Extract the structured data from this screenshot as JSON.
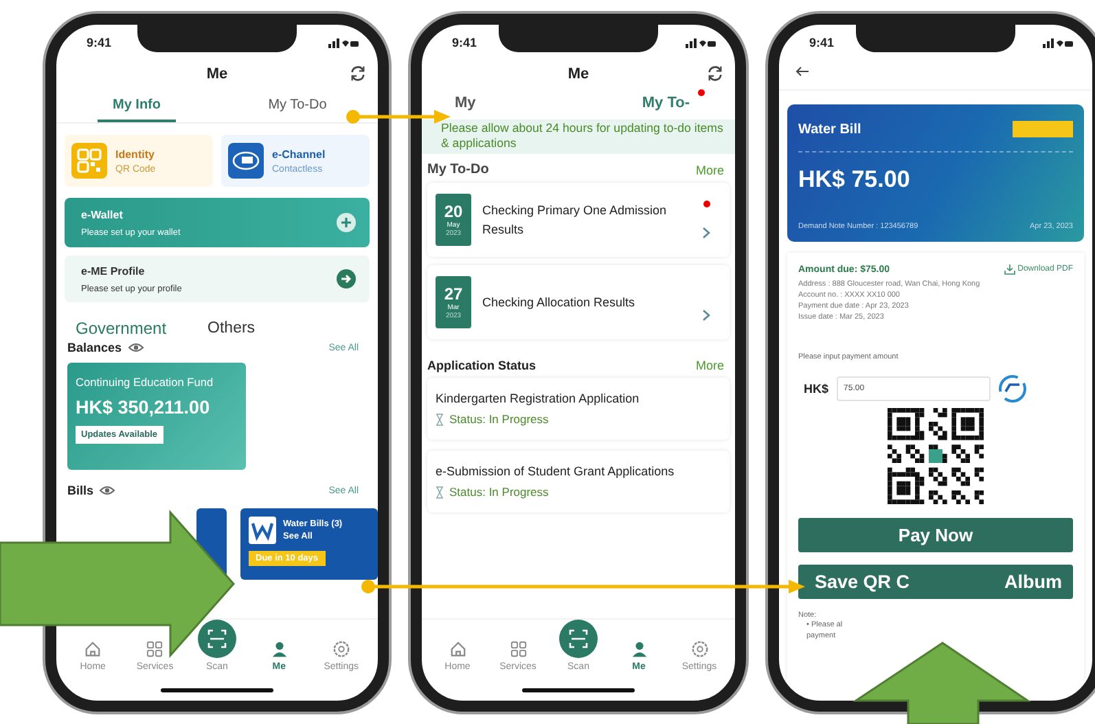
{
  "my_info_screen": {
    "time": "9:41",
    "title": "Me",
    "tabs": [
      {
        "label": "My Info",
        "selected": true
      },
      {
        "label": "My To-Do",
        "selected": false
      }
    ],
    "tiles": [
      {
        "kind": "qr",
        "title": "Identity",
        "subtitle": "QR Code"
      },
      {
        "kind": "echannel",
        "title": "e-Channel",
        "subtitle": "Contactless"
      }
    ],
    "cards": [
      {
        "kind": "wallet",
        "title": "e-Wallet",
        "subtitle": "Please set up your wallet"
      },
      {
        "kind": "profile",
        "title": "e-ME Profile",
        "subtitle": "Please set up your profile"
      }
    ],
    "segments": [
      {
        "label": "Government",
        "selected": true
      },
      {
        "label": "Others",
        "selected": false
      }
    ],
    "balances": {
      "title": "Balances",
      "see_all": "See All",
      "fund": "Continuing Education Fund",
      "amount": "HK$ 350,211.00",
      "badge": "Updates Available"
    },
    "bills": {
      "title": "Bills",
      "see_all": "See All",
      "card": {
        "title": "Water Bills (3)",
        "link": "See All",
        "due": "Due in 10 days"
      }
    },
    "nav": [
      {
        "kind": "home",
        "label": "Home",
        "selected": false
      },
      {
        "kind": "services",
        "label": "Services",
        "selected": false
      },
      {
        "kind": "scan",
        "label": "Scan",
        "selected": false
      },
      {
        "kind": "me",
        "label": "Me",
        "selected": true
      },
      {
        "kind": "settings",
        "label": "Settings",
        "selected": false
      }
    ]
  },
  "my_todo_screen": {
    "time": "9:41",
    "title": "Me",
    "tabs": [
      {
        "label": "My",
        "selected": false,
        "unread": false
      },
      {
        "label": "My To-",
        "selected": true,
        "unread": true
      }
    ],
    "banner": "Please allow about 24 hours for updating to-do items & applications",
    "todo_section": {
      "title": "My To-Do",
      "more": "More"
    },
    "todos": [
      {
        "day": "20",
        "month": "May",
        "year": "2023",
        "title": "Checking Primary One Admission Results",
        "unread": true
      },
      {
        "day": "27",
        "month": "Mar",
        "year": "2023",
        "title": "Checking Allocation Results",
        "unread": false
      }
    ],
    "applications_section": {
      "title": "Application Status",
      "more": "More"
    },
    "applications": [
      {
        "title": "Kindergarten Registration Application",
        "status": "Status: In Progress"
      },
      {
        "title": "e-Submission of Student Grant Applications",
        "status": "Status: In Progress"
      }
    ],
    "nav": [
      {
        "kind": "home",
        "label": "Home",
        "selected": false
      },
      {
        "kind": "services",
        "label": "Services",
        "selected": false
      },
      {
        "kind": "scan",
        "label": "Scan",
        "selected": false
      },
      {
        "kind": "me",
        "label": "Me",
        "selected": true
      },
      {
        "kind": "settings",
        "label": "Settings",
        "selected": false
      }
    ]
  },
  "water_bill_screen": {
    "time": "9:41",
    "bill_card": {
      "title": "Water Bill",
      "amount": "HK$ 75.00",
      "demand_note": "Demand Note Number : 123456789",
      "date": "Apr 23, 2023"
    },
    "details": {
      "amount_due": "Amount due: $75.00",
      "download": "Download PDF",
      "lines": [
        "Address : 888 Gloucester road, Wan Chai, Hong Kong",
        "Account no. : XXXX XX10 000",
        "Payment due date : Apr 23, 2023",
        "Issue date : Mar 25, 2023"
      ]
    },
    "payment": {
      "prompt": "Please input payment amount",
      "currency": "HK$",
      "value": "75.00"
    },
    "pay_button": "Pay Now",
    "save_button": {
      "start": "Save QR C",
      "end": "Album"
    },
    "note": {
      "title": "Note:",
      "lines": [
        "• Please al",
        "payment"
      ]
    }
  }
}
